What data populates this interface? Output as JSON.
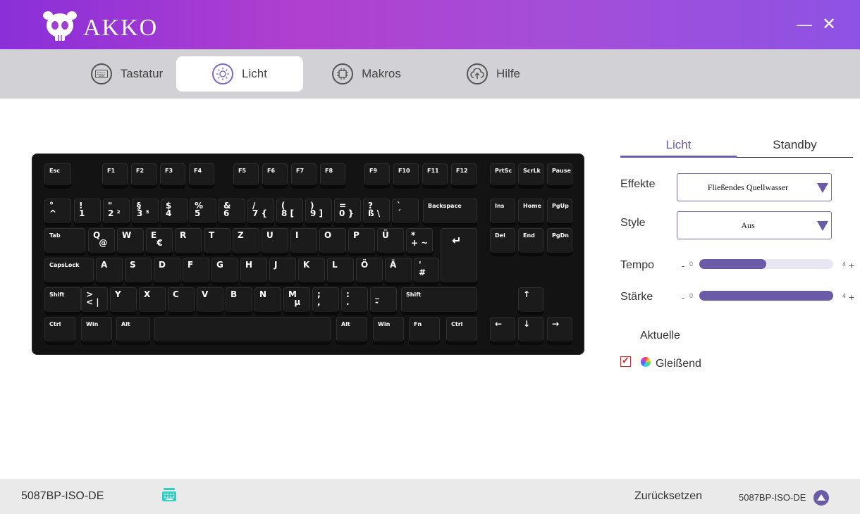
{
  "app": {
    "brand": "AKKO"
  },
  "window": {
    "minimize_glyph": "—",
    "close_glyph": "✕"
  },
  "tabs": [
    {
      "label": "Tastatur",
      "icon": "keyboard-icon",
      "active": false
    },
    {
      "label": "Licht",
      "icon": "light-icon",
      "active": true
    },
    {
      "label": "Makros",
      "icon": "chip-icon",
      "active": false
    },
    {
      "label": "Hilfe",
      "icon": "cloud-icon",
      "active": false
    }
  ],
  "keyboard": {
    "row_fn": [
      "Esc",
      "F1",
      "F2",
      "F3",
      "F4",
      "F5",
      "F6",
      "F7",
      "F8",
      "F9",
      "F10",
      "F11",
      "F12",
      "PrtSc",
      "ScrLk",
      "Pause"
    ],
    "row_num": [
      "°\n^",
      "!\n1",
      "\"\n2 ²",
      "§\n3 ³",
      "$\n4",
      "%\n5",
      "&\n6",
      "/\n7 {",
      "(\n8 [",
      ")\n9 ]",
      "=\n0 }",
      "?\nß \\",
      "`\n´",
      "Backspace",
      "Ins",
      "Home",
      "PgUp"
    ],
    "row_q": [
      "Tab",
      "Q\n  @",
      "W",
      "E\n  €",
      "R",
      "T",
      "Z",
      "U",
      "I",
      "O",
      "P",
      "Ü",
      "*\n+ ~",
      "↵",
      "Del",
      "End",
      "PgDn"
    ],
    "row_a": [
      "CapsLock",
      "A",
      "S",
      "D",
      "F",
      "G",
      "H",
      "J",
      "K",
      "L",
      "Ö",
      "Ä",
      "'\n#"
    ],
    "row_z": [
      "Shift",
      ">\n< |",
      "Y",
      "X",
      "C",
      "V",
      "B",
      "N",
      "M\n  µ",
      ";\n,",
      ":\n.",
      "_\n-",
      "Shift",
      "↑"
    ],
    "row_bottom": [
      "Ctrl",
      "Win",
      "Alt",
      "",
      "Alt",
      "Win",
      "Fn",
      "Ctrl",
      "←",
      "↓",
      "→"
    ]
  },
  "panel": {
    "tabs": [
      {
        "label": "Licht",
        "active": true
      },
      {
        "label": "Standby",
        "active": false
      }
    ],
    "effect_label": "Effekte",
    "effect_value": "Fließendes Quellwasser",
    "style_label": "Style",
    "style_value": "Aus",
    "tempo": {
      "label": "Tempo",
      "min": "0",
      "max": "4",
      "value": 2,
      "minus": "-",
      "plus": "+"
    },
    "strength": {
      "label": "Stärke",
      "min": "0",
      "max": "4",
      "value": 4,
      "minus": "-",
      "plus": "+"
    },
    "current_label": "Aktuelle",
    "glow": {
      "label": "Gleißend",
      "checked": true,
      "check_glyph": "✓"
    }
  },
  "footer": {
    "model": "5087BP-ISO-DE",
    "reset_label": "Zurücksetzen",
    "model_right": "5087BP-ISO-DE"
  },
  "colors": {
    "accent": "#6a5aa8",
    "title_gradient_start": "#8a2fd9",
    "title_gradient_end": "#8e52e4"
  }
}
